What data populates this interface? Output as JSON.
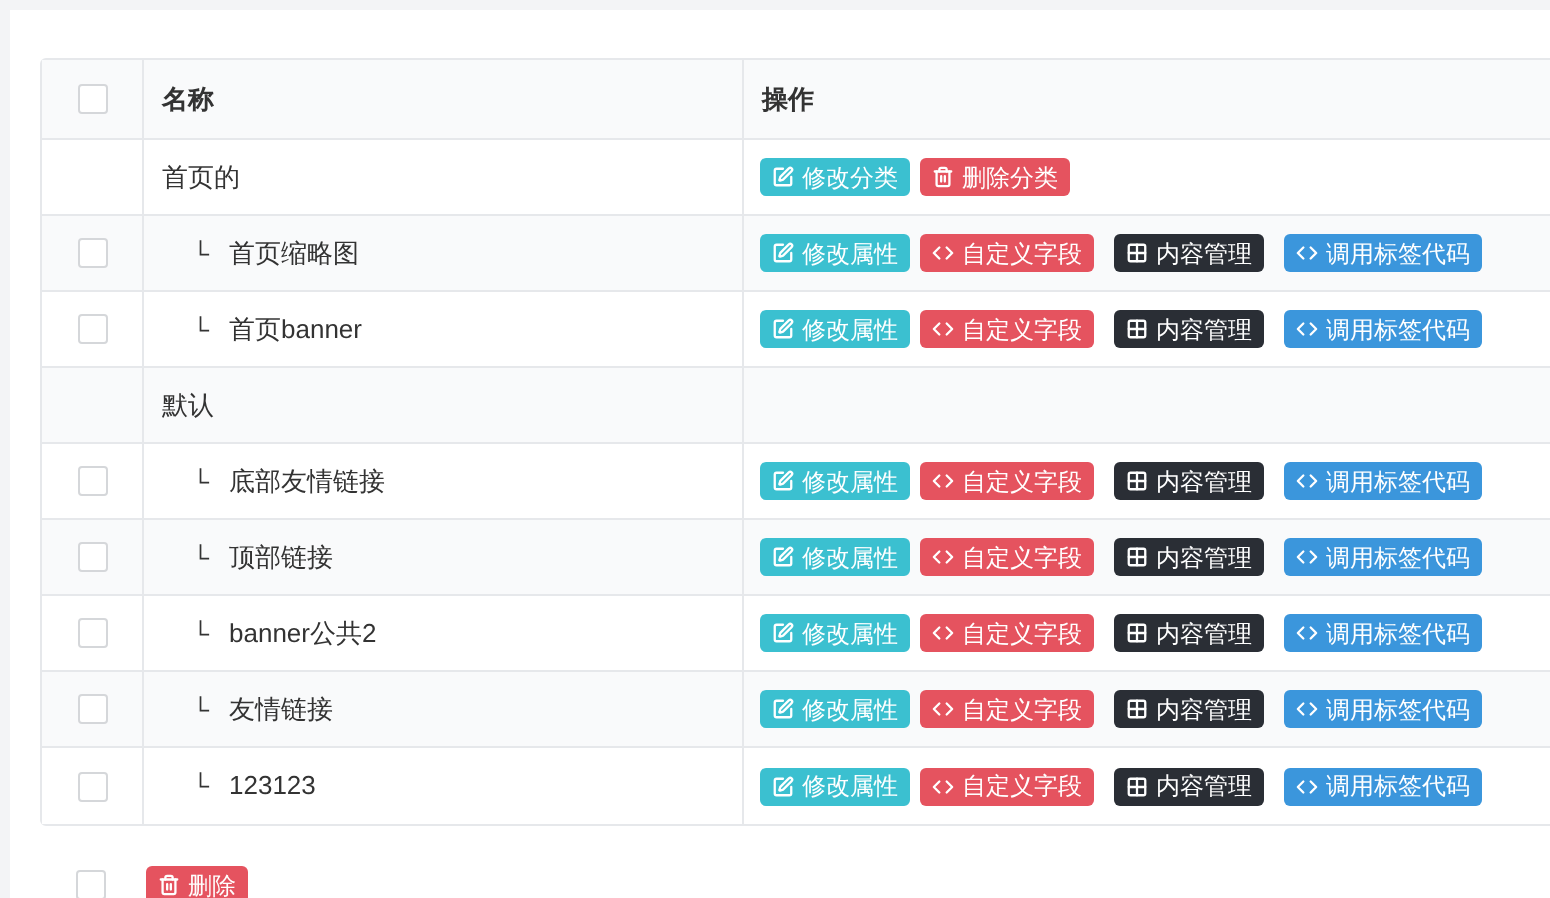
{
  "table": {
    "header": {
      "checked": false,
      "columns": [
        "名称",
        "操作"
      ]
    },
    "groups": [
      {
        "name": "首页的",
        "actions": [
          {
            "kind": "edit",
            "label": "修改分类"
          },
          {
            "kind": "delete",
            "label": "删除分类"
          }
        ],
        "children": [
          {
            "branch": "└",
            "name": "首页缩略图",
            "checked": false,
            "actions": [
              {
                "kind": "edit",
                "label": "修改属性"
              },
              {
                "kind": "code",
                "label": "自定义字段"
              },
              {
                "kind": "table",
                "label": "内容管理"
              },
              {
                "kind": "tag",
                "label": "调用标签代码"
              }
            ]
          },
          {
            "branch": "└",
            "name": "首页banner",
            "checked": false,
            "actions": [
              {
                "kind": "edit",
                "label": "修改属性"
              },
              {
                "kind": "code",
                "label": "自定义字段"
              },
              {
                "kind": "table",
                "label": "内容管理"
              },
              {
                "kind": "tag",
                "label": "调用标签代码"
              }
            ]
          }
        ]
      },
      {
        "name": "默认",
        "children": [
          {
            "branch": "└",
            "name": "底部友情链接",
            "checked": false,
            "actions": [
              {
                "kind": "edit",
                "label": "修改属性"
              },
              {
                "kind": "code",
                "label": "自定义字段"
              },
              {
                "kind": "table",
                "label": "内容管理"
              },
              {
                "kind": "tag",
                "label": "调用标签代码"
              }
            ]
          },
          {
            "branch": "└",
            "name": "顶部链接",
            "checked": false,
            "actions": [
              {
                "kind": "edit",
                "label": "修改属性"
              },
              {
                "kind": "code",
                "label": "自定义字段"
              },
              {
                "kind": "table",
                "label": "内容管理"
              },
              {
                "kind": "tag",
                "label": "调用标签代码"
              }
            ]
          },
          {
            "branch": "└",
            "name": "banner公共2",
            "checked": false,
            "actions": [
              {
                "kind": "edit",
                "label": "修改属性"
              },
              {
                "kind": "code",
                "label": "自定义字段"
              },
              {
                "kind": "table",
                "label": "内容管理"
              },
              {
                "kind": "tag",
                "label": "调用标签代码"
              }
            ]
          },
          {
            "branch": "└",
            "name": "友情链接",
            "checked": false,
            "actions": [
              {
                "kind": "edit",
                "label": "修改属性"
              },
              {
                "kind": "code",
                "label": "自定义字段"
              },
              {
                "kind": "table",
                "label": "内容管理"
              },
              {
                "kind": "tag",
                "label": "调用标签代码"
              }
            ]
          },
          {
            "branch": "└",
            "name": "123123",
            "checked": false,
            "actions": [
              {
                "kind": "edit",
                "label": "修改属性"
              },
              {
                "kind": "code",
                "label": "自定义字段"
              },
              {
                "kind": "table",
                "label": "内容管理"
              },
              {
                "kind": "tag",
                "label": "调用标签代码"
              }
            ]
          }
        ]
      }
    ]
  },
  "footer": {
    "checked": false,
    "delete_button": {
      "kind": "delete",
      "label": "删除"
    }
  }
}
